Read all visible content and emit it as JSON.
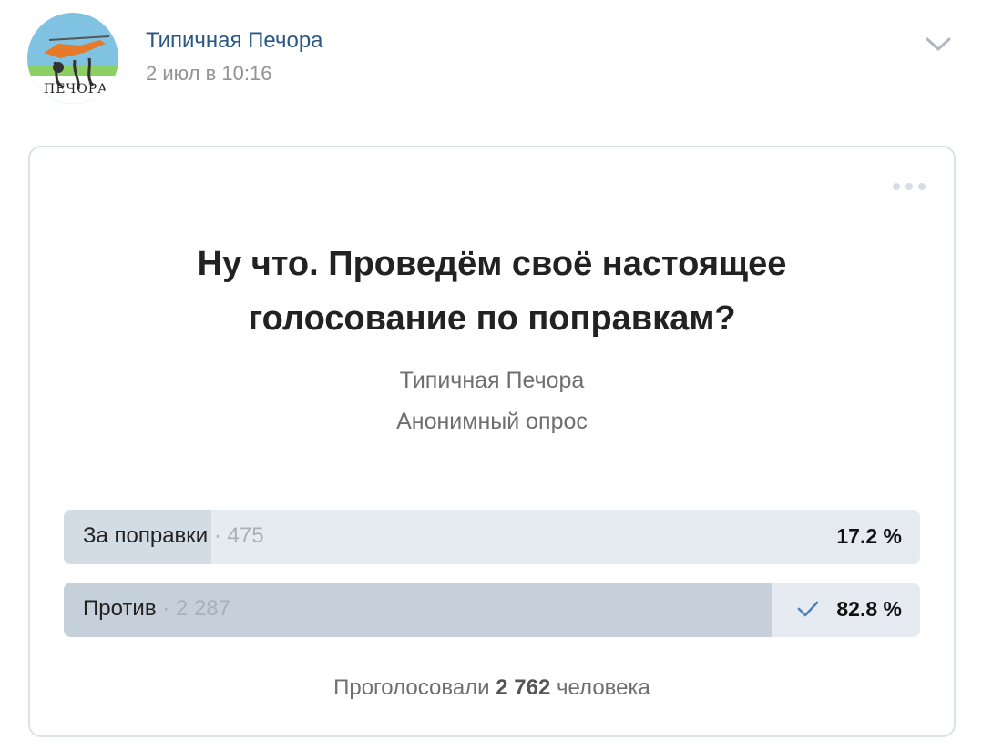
{
  "post": {
    "author": "Типичная Печора",
    "date": "2 июл в 10:16",
    "avatar_text": "ПЕЧОРА"
  },
  "poll": {
    "question_line1": "Ну что. Проведём своё настоящее",
    "question_line2": "голосование по поправкам?",
    "owner": "Типичная Печора",
    "type": "Анонимный опрос",
    "answers": [
      {
        "label": "За поправки",
        "separator": "·",
        "count": "475",
        "percent": "17.2 %",
        "share": 0.172,
        "voted": false
      },
      {
        "label": "Против",
        "separator": "·",
        "count": "2 287",
        "percent": "82.8 %",
        "share": 0.828,
        "voted": true
      }
    ],
    "footer_prefix": "Проголосовали",
    "footer_total": "2 762",
    "footer_suffix": "человека"
  },
  "colors": {
    "link": "#2a5885",
    "bar_bg": "#e5ebf1",
    "bar_fill": "#c5d0db",
    "check": "#5181b8"
  },
  "icons": {
    "header_menu": "chevron-down-icon",
    "poll_menu": "more-dots-icon",
    "voted": "checkmark-icon"
  }
}
